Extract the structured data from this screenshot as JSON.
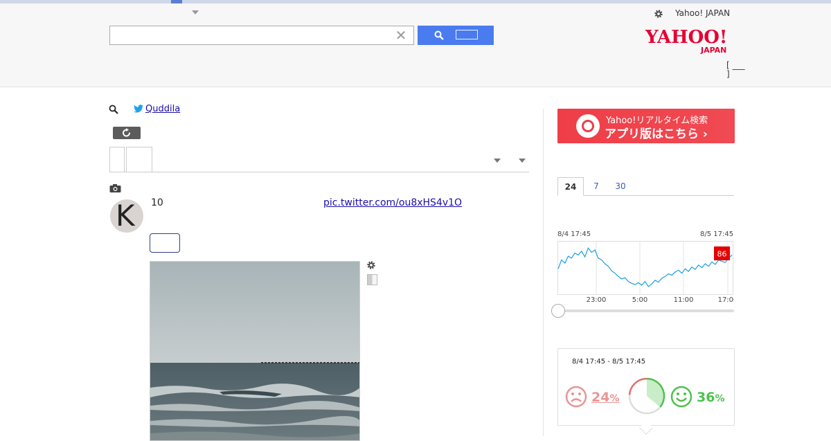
{
  "header": {
    "service_link": "Yahoo! JAPAN",
    "logo_top": "YAHOO!",
    "logo_bottom": "JAPAN",
    "search": {
      "value": "",
      "placeholder": ""
    },
    "bracket_text": "[ ___\n]"
  },
  "result": {
    "user_link": "Quddila",
    "tweet_number": "10",
    "pic_link": "pic.twitter.com/ou8xHS4v1O"
  },
  "sidebar": {
    "banner_line1": "Yahoo!リアルタイム検索",
    "banner_line2": "アプリ版はこちら ›",
    "period_tabs": [
      "24",
      "7",
      "30"
    ],
    "active_tab": "24",
    "sentiment": {
      "range": "8/4 17:45 - 8/5 17:45",
      "negative_pct": "24",
      "positive_pct": "36",
      "pct_unit": "%",
      "neutral_pct": 40
    }
  },
  "chart_data": {
    "type": "line",
    "start_label": "8/4 17:45",
    "end_label": "8/5 17:45",
    "x_ticks": [
      "23:00",
      "5:00",
      "11:00",
      "17:00"
    ],
    "current_value": "86",
    "line_color": "#1a9fe0",
    "badge_color": "#e40000",
    "values": [
      38,
      52,
      47,
      58,
      55,
      63,
      60,
      66,
      57,
      71,
      64,
      68,
      55,
      52,
      46,
      42,
      35,
      31,
      26,
      22,
      24,
      18,
      15,
      13,
      16,
      12,
      18,
      10,
      14,
      20,
      17,
      23,
      26,
      30,
      28,
      33,
      36,
      31,
      38,
      34,
      41,
      37,
      44,
      40,
      46,
      42,
      49,
      45,
      52,
      50,
      48,
      55,
      60
    ]
  }
}
